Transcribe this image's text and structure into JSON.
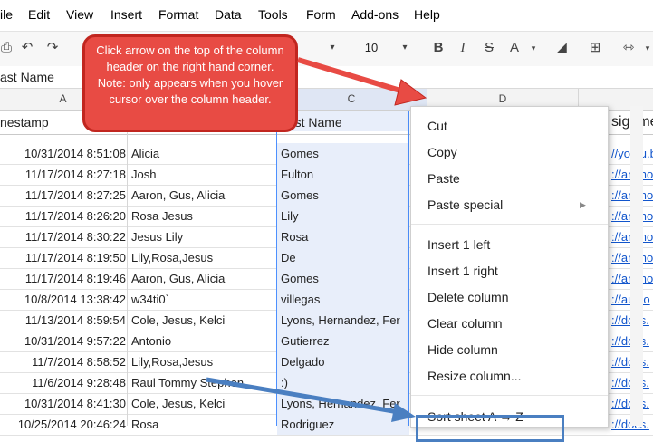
{
  "menu": [
    "ile",
    "Edit",
    "View",
    "Insert",
    "Format",
    "Data",
    "Tools",
    "Form",
    "Add-ons",
    "Help"
  ],
  "toolbar": {
    "font_size": "10",
    "bold": "B",
    "italic": "I",
    "strike": "S",
    "text_color": "A"
  },
  "formula_bar": {
    "value": "ast Name"
  },
  "columns": [
    "A",
    "C",
    "D"
  ],
  "header_row": {
    "a": "nestamp",
    "c": "Last Name",
    "e": "signme"
  },
  "rows": [
    {
      "a": "10/31/2014 8:51:08",
      "b": "Alicia",
      "c": "Gomes",
      "e": "//youtu.b"
    },
    {
      "a": "11/17/2014 8:27:18",
      "b": "Josh",
      "c": "Fulton",
      "e": "://animo"
    },
    {
      "a": "11/17/2014 8:27:25",
      "b": "Aaron, Gus, Alicia",
      "c": "Gomes",
      "e": "://animo"
    },
    {
      "a": "11/17/2014 8:26:20",
      "b": "Rosa Jesus",
      "c": "Lily",
      "e": "://animo"
    },
    {
      "a": "11/17/2014 8:30:22",
      "b": "Jesus Lily",
      "c": "Rosa",
      "e": "://animo"
    },
    {
      "a": "11/17/2014 8:19:50",
      "b": "Lily,Rosa,Jesus",
      "c": "De",
      "e": "://animo"
    },
    {
      "a": "11/17/2014 8:19:46",
      "b": "Aaron, Gus, Alicia",
      "c": "Gomes",
      "e": "://animo"
    },
    {
      "a": "10/8/2014 13:38:42",
      "b": "w34ti0`",
      "c": "villegas",
      "e": "://audio"
    },
    {
      "a": "11/13/2014 8:59:54",
      "b": "Cole, Jesus, Kelci",
      "c": "Lyons, Hernandez, Fer",
      "e": "://docs."
    },
    {
      "a": "10/31/2014 9:57:22",
      "b": "Antonio",
      "c": "Gutierrez",
      "e": "://docs."
    },
    {
      "a": "11/7/2014 8:58:52",
      "b": "Lily,Rosa,Jesus",
      "c": "Delgado",
      "e": "://docs."
    },
    {
      "a": "11/6/2014 9:28:48",
      "b": "Raul Tommy Stephen",
      "c": ":)",
      "e": "://docs."
    },
    {
      "a": "10/31/2014 8:41:30",
      "b": "Cole, Jesus, Kelci",
      "c": "Lyons, Hernandez, Fer",
      "e": "://docs."
    },
    {
      "a": "10/25/2014 20:46:24",
      "b": "Rosa",
      "c": "Rodriguez",
      "e": "://docs."
    }
  ],
  "callout": {
    "text": "Click arrow on the top of the column header on the right hand corner.  Note:  only appears when you hover cursor over the column header."
  },
  "context_menu": {
    "items_group1": [
      "Cut",
      "Copy",
      "Paste",
      "Paste special"
    ],
    "items_group2": [
      "Insert 1 left",
      "Insert 1 right",
      "Delete column",
      "Clear column",
      "Hide column",
      "Resize column..."
    ],
    "sort": "Sort sheet A → Z"
  },
  "colors": {
    "callout": "#e84b44",
    "selection": "#e8eefa",
    "arrow": "#4a7fc1"
  }
}
